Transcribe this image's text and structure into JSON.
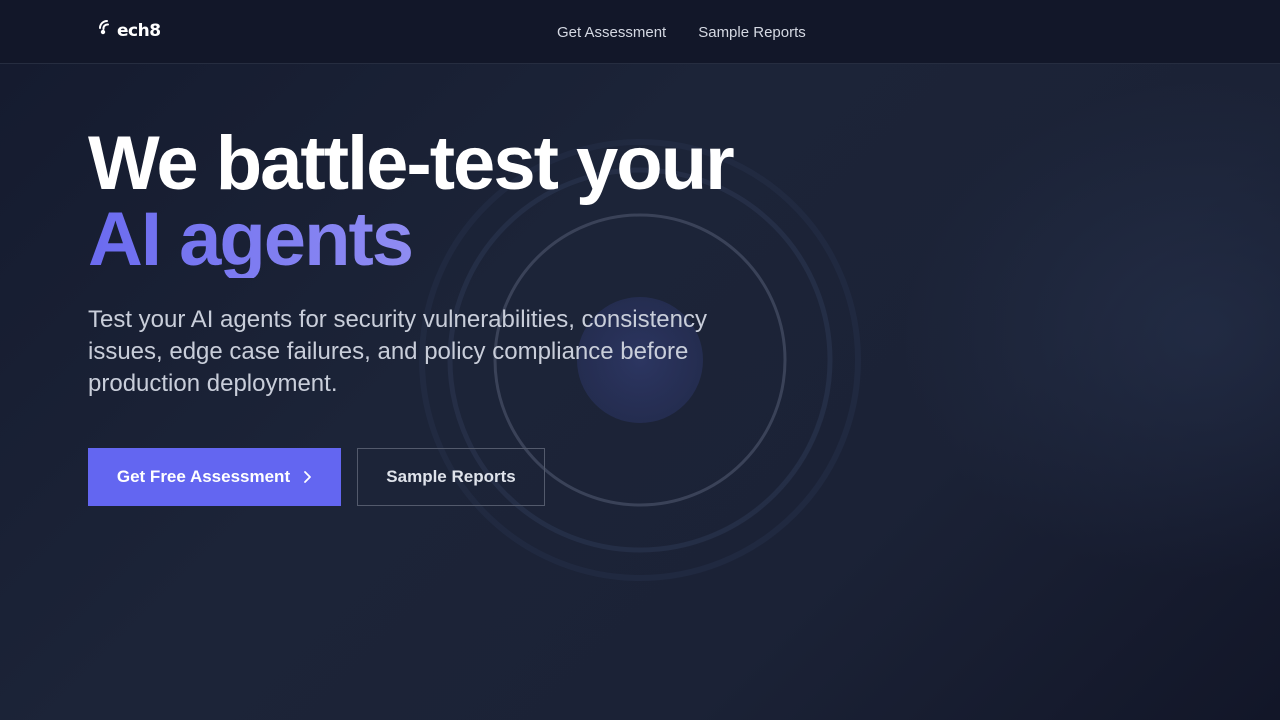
{
  "brand": {
    "name": "ech8",
    "logo_icon": "signal-waves-icon"
  },
  "nav": {
    "items": [
      {
        "label": "Get Assessment"
      },
      {
        "label": "Sample Reports"
      }
    ]
  },
  "hero": {
    "title_line1": "We battle-test your",
    "title_line2": "AI agents",
    "subtitle": "Test your AI agents for security vulnerabilities, consistency issues, edge case failures, and policy compliance before production deployment.",
    "primary_cta": "Get Free Assessment",
    "primary_cta_icon": "chevron-right-icon",
    "secondary_cta": "Sample Reports"
  },
  "colors": {
    "accent": "#6366f1",
    "header_bg": "#121729",
    "page_bg": "#1c2438",
    "title_gradient_start": "#6b6bf0",
    "title_gradient_end": "#c8c6f6"
  }
}
